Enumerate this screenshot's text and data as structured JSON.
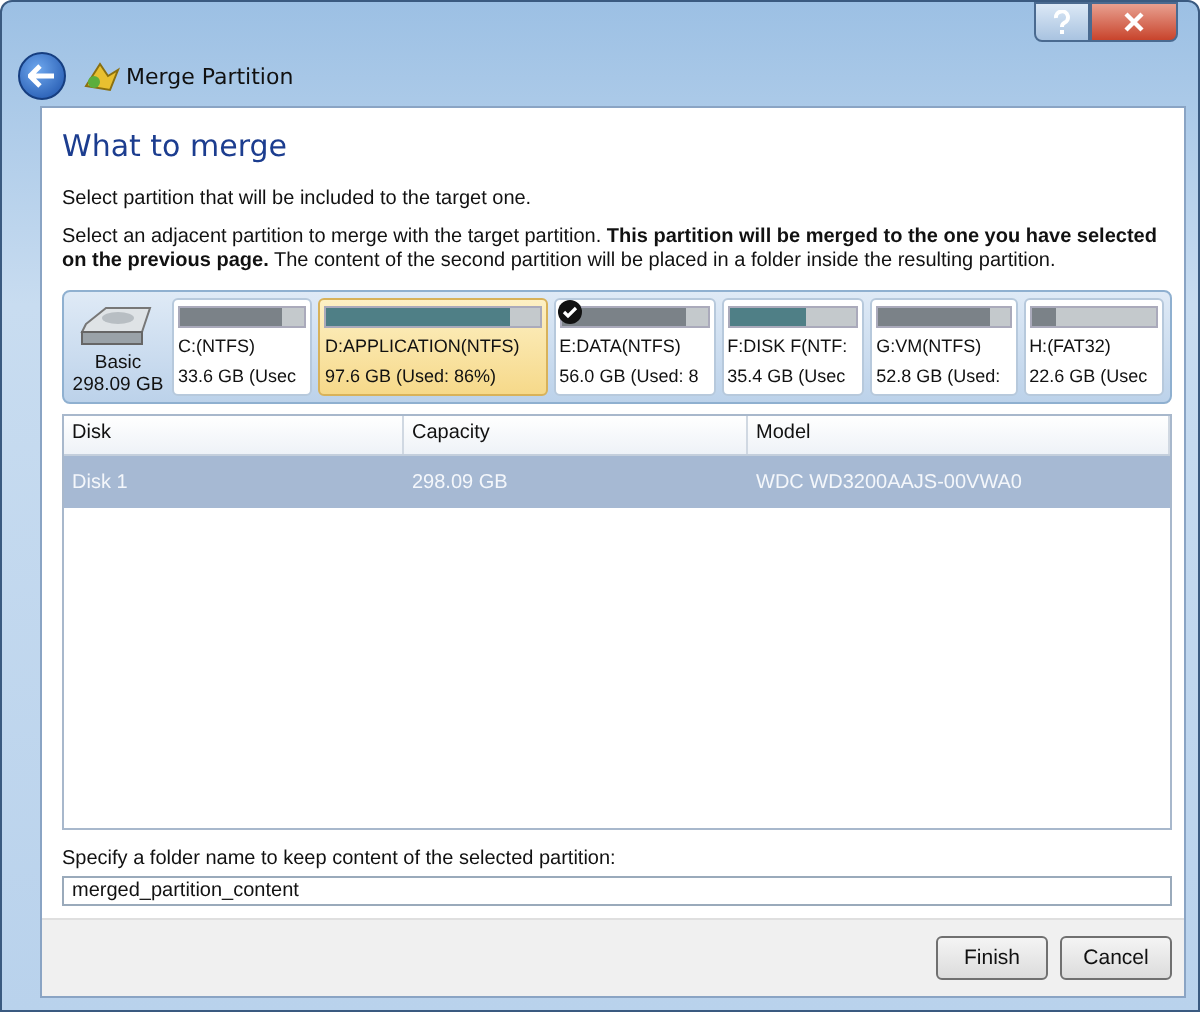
{
  "window": {
    "title": "Merge Partition"
  },
  "heading": "What to merge",
  "intro": "Select partition that will be included to the target one.",
  "description": "Select an adjacent partition to merge with the target partition. **This partition will be merged to the one you have selected on the previous page.** The content of the second partition will be placed in a folder inside the resulting partition.",
  "disk": {
    "type": "Basic",
    "size": "298.09 GB"
  },
  "partitions": [
    {
      "name": "C:(NTFS)",
      "info": "33.6 GB (Usec",
      "level": 0.82,
      "color": "#7b8288",
      "selected": false,
      "checked": false
    },
    {
      "name": "D:APPLICATION(NTFS)",
      "info": "97.6 GB (Used: 86%)",
      "level": 0.86,
      "color": "#4f7f86",
      "selected": true,
      "checked": false
    },
    {
      "name": "E:DATA(NTFS)",
      "info": "56.0 GB (Used: 8",
      "level": 0.85,
      "color": "#7b8288",
      "selected": false,
      "checked": true
    },
    {
      "name": "F:DISK F(NTF:",
      "info": "35.4 GB (Usec",
      "level": 0.6,
      "color": "#4f7f86",
      "selected": false,
      "checked": false
    },
    {
      "name": "G:VM(NTFS)",
      "info": "52.8 GB (Used:",
      "level": 0.85,
      "color": "#7b8288",
      "selected": false,
      "checked": false
    },
    {
      "name": "H:(FAT32)",
      "info": "22.6 GB (Usec",
      "level": 0.2,
      "color": "#7b8288",
      "selected": false,
      "checked": false
    }
  ],
  "table": {
    "columns": [
      "Disk",
      "Capacity",
      "Model"
    ],
    "rows": [
      {
        "cells": [
          "Disk 1",
          "298.09 GB",
          "WDC WD3200AAJS-00VWA0"
        ],
        "selected": true
      }
    ]
  },
  "folder": {
    "label": "Specify a folder name to keep content of the selected partition:",
    "value": "merged_partition_content"
  },
  "buttons": [
    "Finish",
    "Cancel"
  ]
}
